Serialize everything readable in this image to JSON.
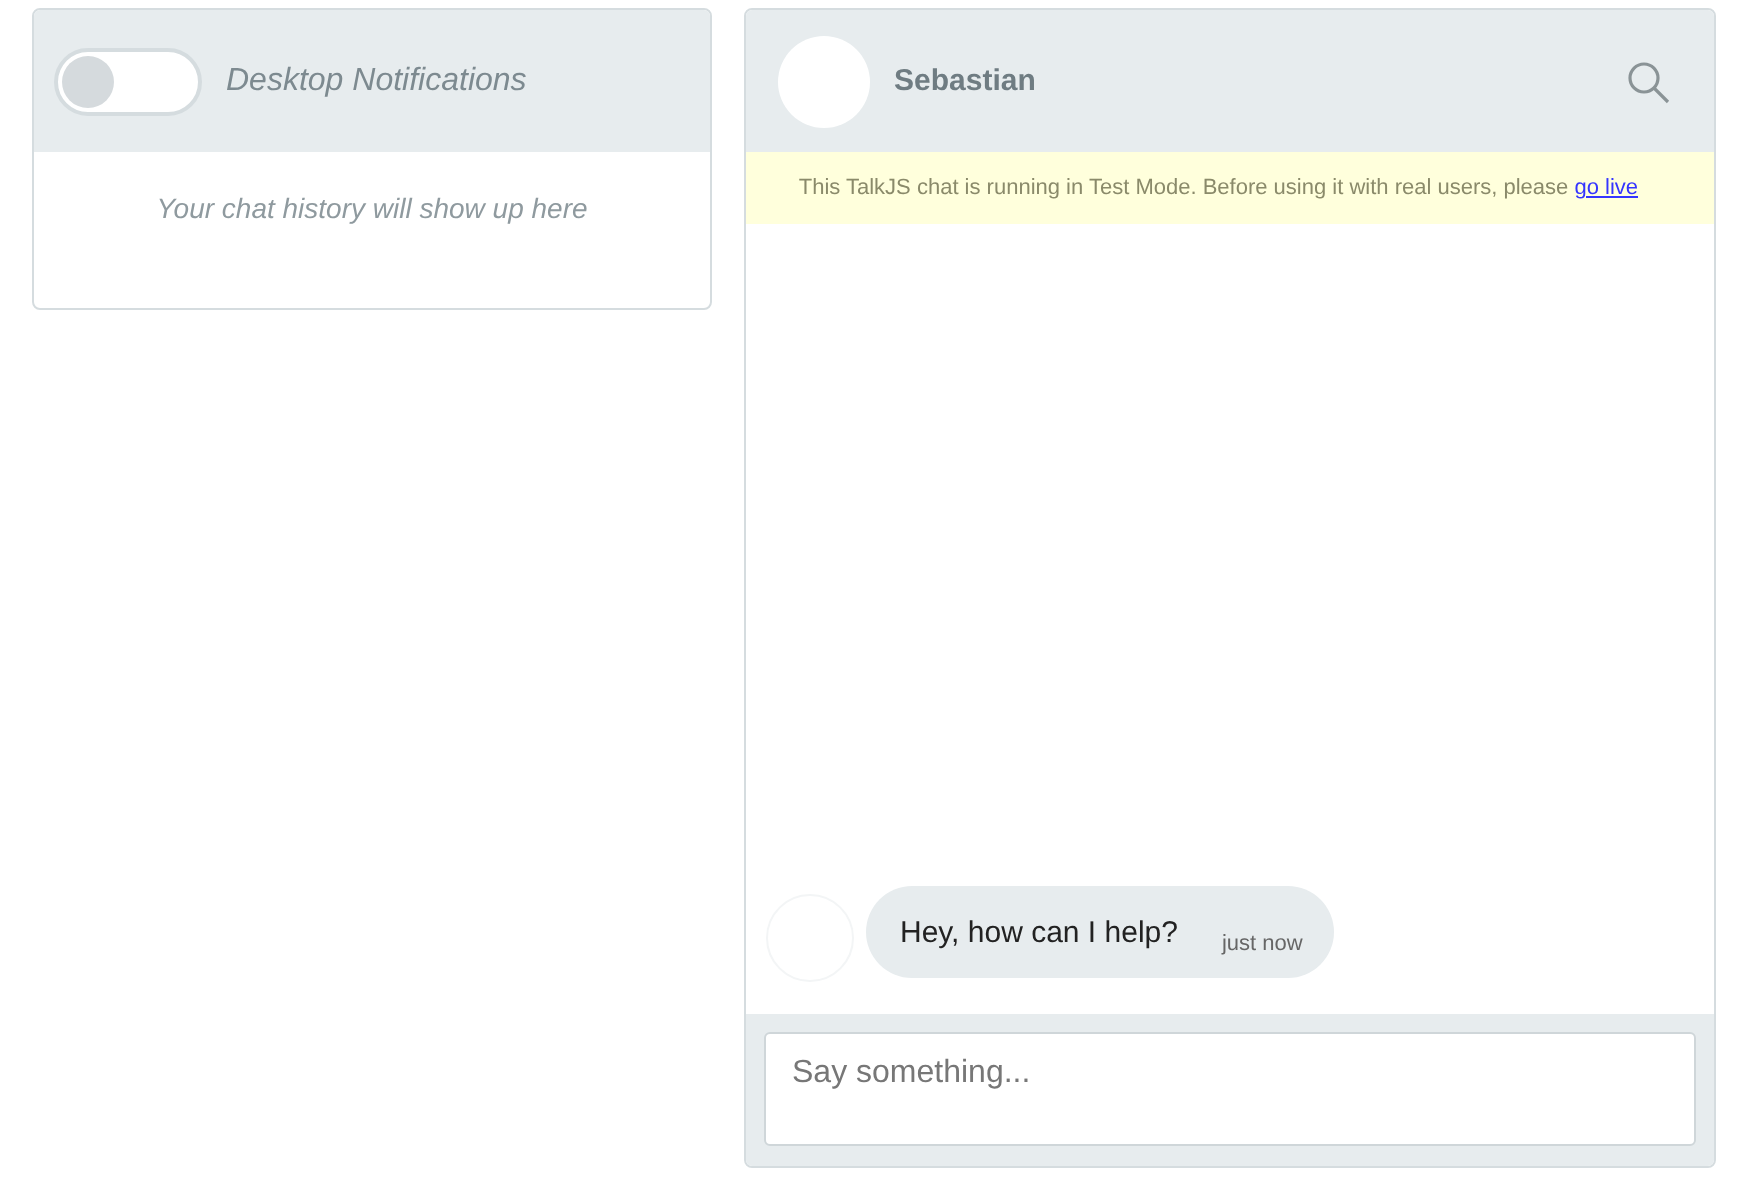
{
  "inbox": {
    "notifications": {
      "label": "Desktop Notifications",
      "on": false
    },
    "empty_text": "Your chat history will show up here"
  },
  "chat": {
    "contact": {
      "name": "Sebastian"
    },
    "banner": {
      "text": "This TalkJS chat is running in Test Mode. Before using it with real users, please ",
      "link": "go live"
    },
    "messages": [
      {
        "text": "Hey, how can I help?",
        "time": "just now"
      }
    ],
    "composer": {
      "placeholder": "Say something..."
    }
  }
}
